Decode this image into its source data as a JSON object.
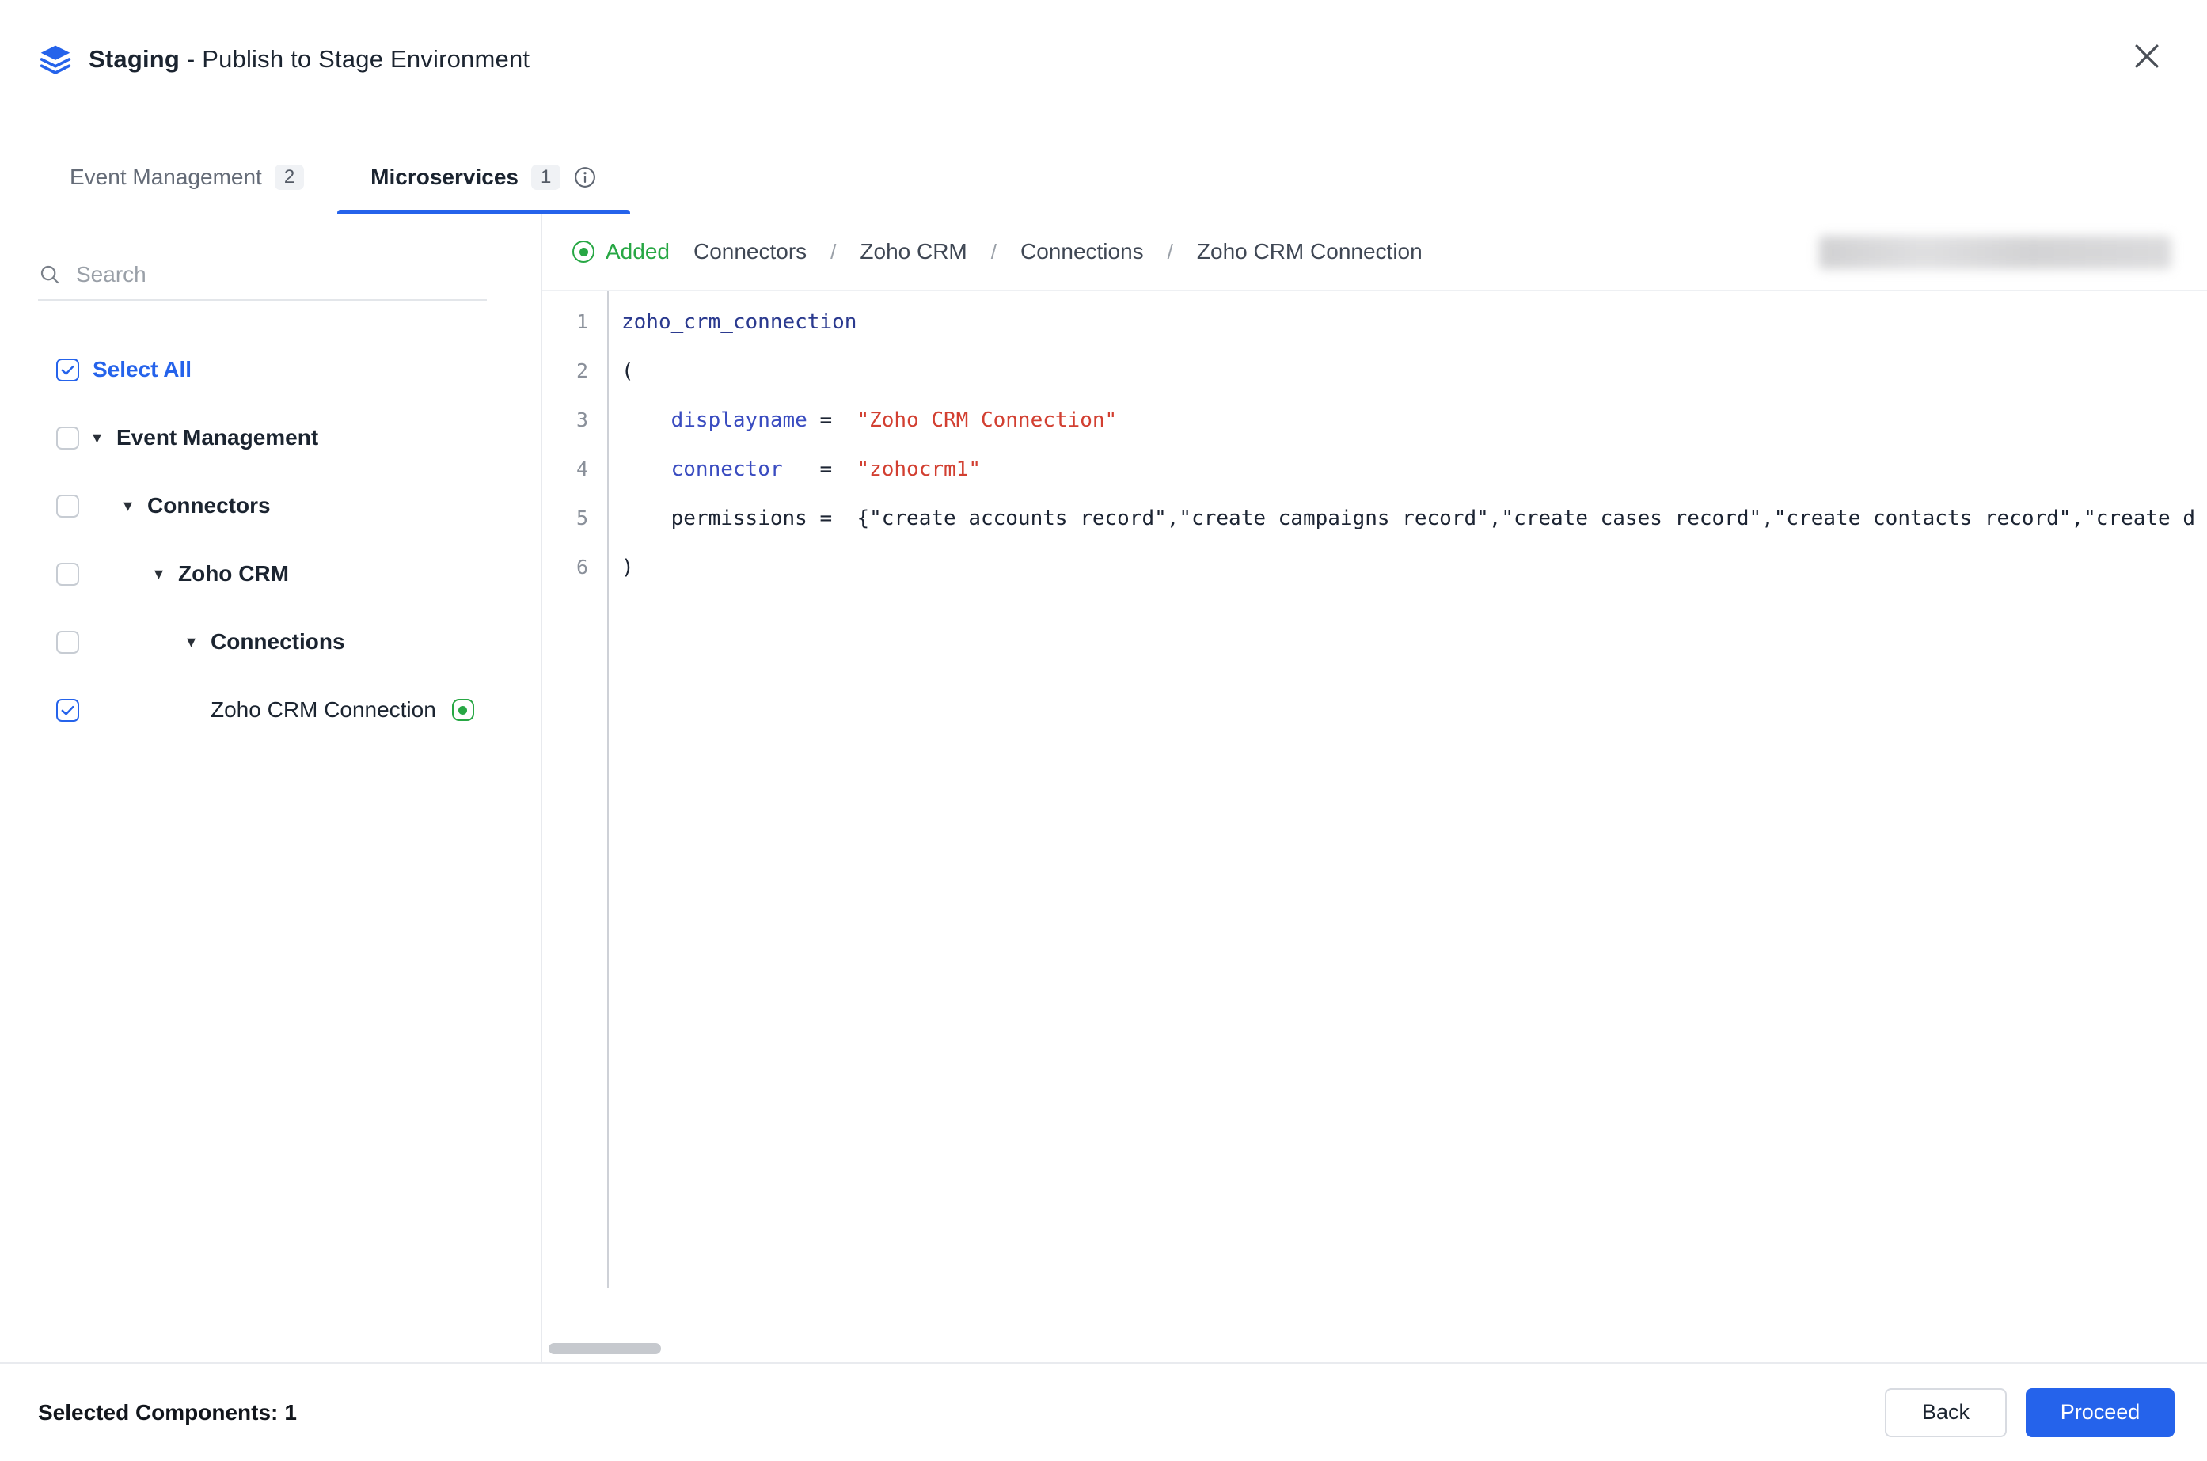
{
  "header": {
    "title_bold": "Staging",
    "title_rest": " - Publish to Stage Environment"
  },
  "tabs": [
    {
      "label": "Event Management",
      "count": "2"
    },
    {
      "label": "Microservices",
      "count": "1"
    }
  ],
  "sidebar": {
    "search_placeholder": "Search",
    "select_all": "Select All",
    "tree": [
      {
        "label": "Event Management"
      },
      {
        "label": "Connectors"
      },
      {
        "label": "Zoho CRM"
      },
      {
        "label": "Connections"
      },
      {
        "label": "Zoho CRM Connection"
      }
    ]
  },
  "main": {
    "status": "Added",
    "separator": "/",
    "breadcrumb": [
      "Connectors",
      "Zoho CRM",
      "Connections",
      "Zoho CRM Connection"
    ],
    "code": {
      "numbers": [
        "1",
        "2",
        "3",
        "4",
        "5",
        "6"
      ],
      "indent": "    ",
      "l1": "zoho_crm_connection",
      "l2": "(",
      "l3_key": "displayname",
      "l3_eq": " =  ",
      "l3_val": "\"Zoho CRM Connection\"",
      "l4_key": "connector",
      "l4_eq": "   =  ",
      "l4_val": "\"zohocrm1\"",
      "l5_key": "permissions",
      "l5_eq": " =  ",
      "l5_val": "{\"create_accounts_record\",\"create_campaigns_record\",\"create_cases_record\",\"create_contacts_record\",\"create_d",
      "l6": ")"
    }
  },
  "footer": {
    "selected_label": "Selected Components:",
    "selected_count": "1",
    "back": "Back",
    "proceed": "Proceed"
  },
  "colors": {
    "accent_blue": "#2563eb",
    "added_green": "#27a744",
    "string_red": "#d23f31",
    "key_blue": "#3a4cc0",
    "name_navy": "#2b3a8f"
  }
}
